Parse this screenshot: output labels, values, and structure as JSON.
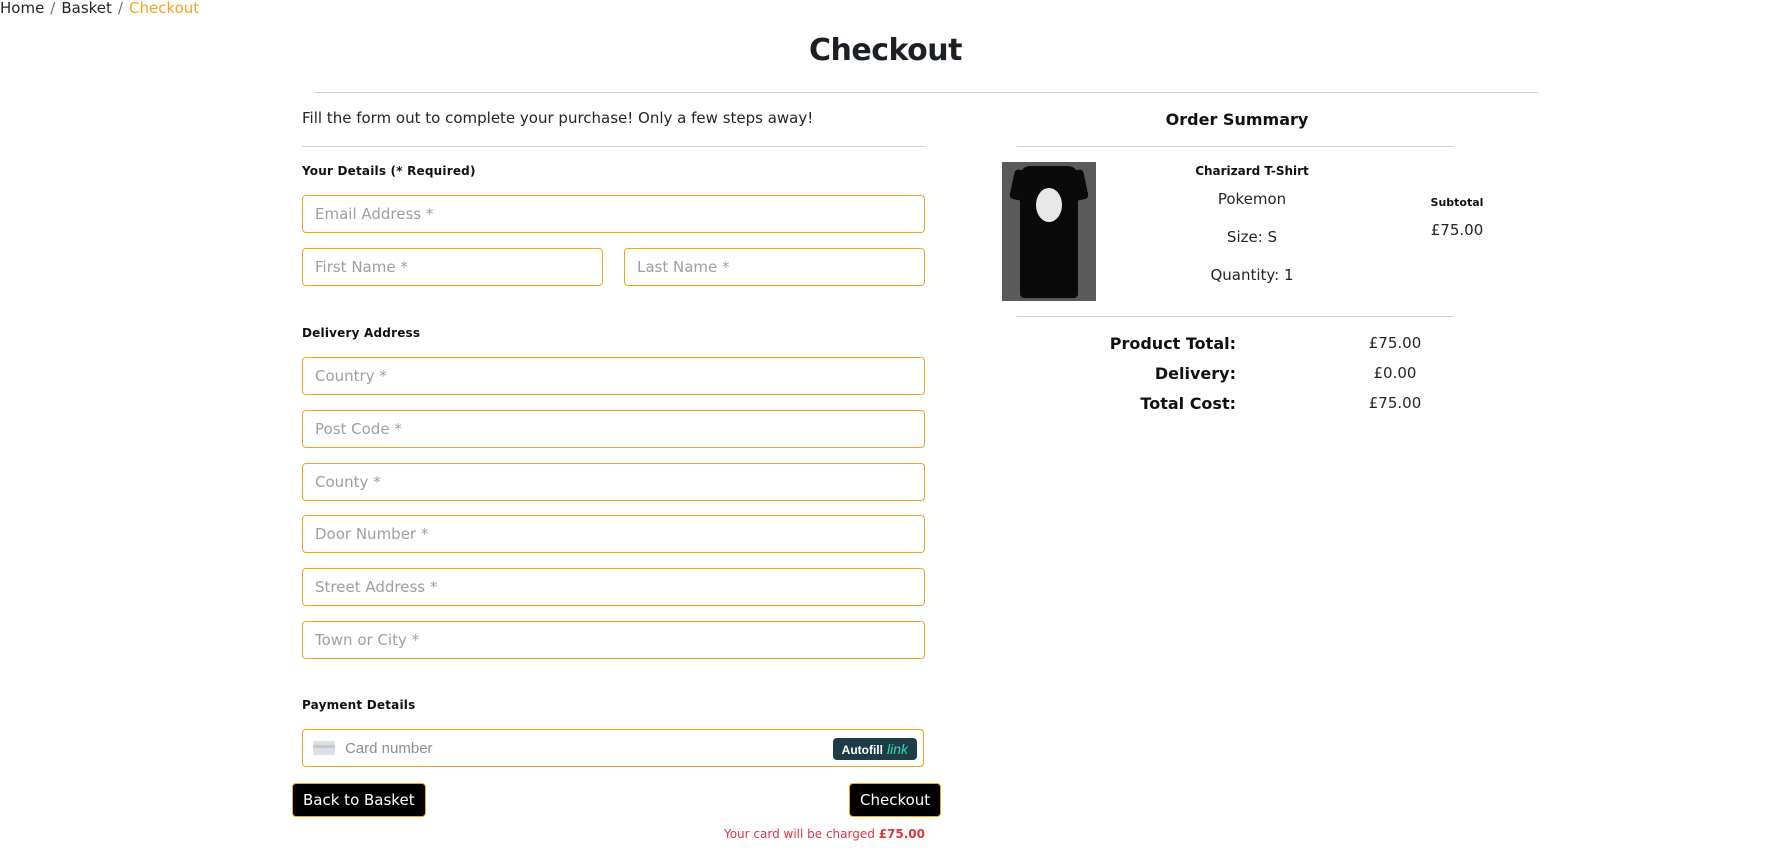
{
  "breadcrumb": {
    "home": "Home",
    "separator": "/",
    "basket": "Basket",
    "current": "Checkout"
  },
  "page": {
    "title": "Checkout",
    "intro": "Fill the form out to complete your purchase! Only a few steps away!"
  },
  "details": {
    "heading": "Your Details (* Required)",
    "email_placeholder": "Email Address *",
    "first_name_placeholder": "First Name *",
    "last_name_placeholder": "Last Name *"
  },
  "delivery": {
    "heading": "Delivery Address",
    "country_placeholder": "Country *",
    "postcode_placeholder": "Post Code *",
    "county_placeholder": "County *",
    "door_placeholder": "Door Number *",
    "street_placeholder": "Street Address *",
    "town_placeholder": "Town or City *"
  },
  "payment": {
    "heading": "Payment Details",
    "card_placeholder": "Card number",
    "autofill_label": "Autofill",
    "autofill_brand": "link"
  },
  "actions": {
    "back_label": "Back to Basket",
    "checkout_label": "Checkout",
    "charge_note": "Your card will be charged",
    "charge_amount": "£75.00"
  },
  "summary": {
    "title": "Order Summary",
    "item": {
      "name": "Charizard T-Shirt",
      "brand": "Pokemon",
      "size": "Size: S",
      "quantity": "Quantity: 1",
      "subtotal_label": "Subtotal",
      "subtotal_value": "£75.00"
    },
    "totals": {
      "product_label": "Product Total:",
      "product_value": "£75.00",
      "delivery_label": "Delivery:",
      "delivery_value": "£0.00",
      "total_label": "Total Cost:",
      "total_value": "£75.00"
    }
  },
  "colors": {
    "accent": "#f0a41d",
    "danger": "#dc3545",
    "button_bg": "#000000",
    "link_badge": "#1d3c45"
  }
}
